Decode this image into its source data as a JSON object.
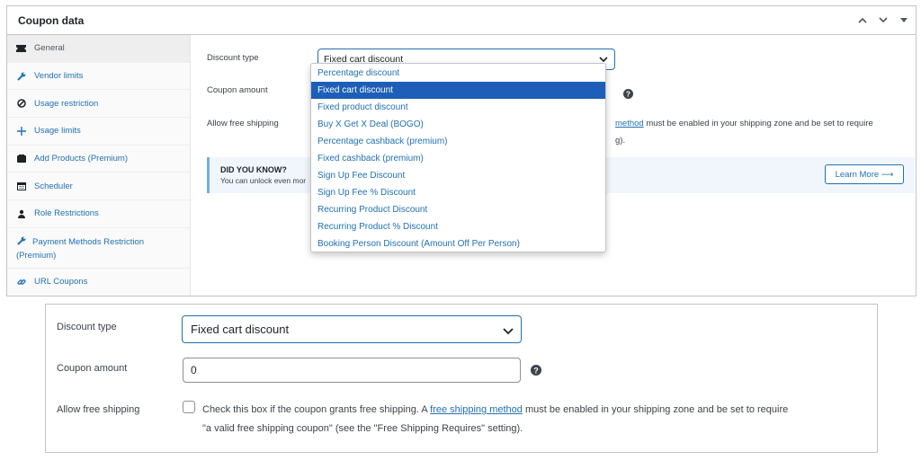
{
  "top_panel": {
    "title": "Coupon data",
    "controls": [
      "chevron-up",
      "chevron-down",
      "triangle-down"
    ],
    "tabs": [
      {
        "label": "General",
        "icon": "ticket-icon",
        "active": true
      },
      {
        "label": "Vendor limits",
        "icon": "wrench-icon"
      },
      {
        "label": "Usage restriction",
        "icon": "block-icon"
      },
      {
        "label": "Usage limits",
        "icon": "plus-icon"
      },
      {
        "label": "Add Products (Premium)",
        "icon": "cart-icon"
      },
      {
        "label": "Scheduler",
        "icon": "calendar-icon"
      },
      {
        "label": "Role Restrictions",
        "icon": "user-icon"
      },
      {
        "label": "Payment Methods Restriction (Premium)",
        "icon": "wrench-icon"
      },
      {
        "label": "URL Coupons",
        "icon": "link-icon"
      }
    ],
    "discount_type_label": "Discount type",
    "discount_type_value": "Fixed cart discount",
    "coupon_amount_label": "Coupon amount",
    "free_shipping_label": "Allow free shipping",
    "shipping_note_link": "method",
    "shipping_note_tail": " must be enabled in your shipping zone and be set to require",
    "shipping_note_line2": "g).",
    "notice_title": "DID YOU KNOW?",
    "notice_text": "You can unlock even mor",
    "learn_more": "Learn More ⟶",
    "dropdown_options": [
      "Percentage discount",
      "Fixed cart discount",
      "Fixed product discount",
      "Buy X Get X Deal (BOGO)",
      "Percentage cashback (premium)",
      "Fixed cashback (premium)",
      "Sign Up Fee Discount",
      "Sign Up Fee % Discount",
      "Recurring Product Discount",
      "Recurring Product % Discount",
      "Booking Person Discount (Amount Off Per Person)"
    ],
    "dropdown_selected": "Fixed cart discount"
  },
  "bottom_panel": {
    "discount_type_label": "Discount type",
    "discount_type_value": "Fixed cart discount",
    "coupon_amount_label": "Coupon amount",
    "coupon_amount_value": "0",
    "free_shipping_label": "Allow free shipping",
    "shipping_text_before": "Check this box if the coupon grants free shipping. A ",
    "shipping_link": "free shipping method",
    "shipping_text_after": " must be enabled in your shipping zone and be set to require",
    "shipping_text_line2": "\"a valid free shipping coupon\" (see the \"Free Shipping Requires\" setting)."
  },
  "colors": {
    "accent": "#2271b1",
    "selected_bg": "#1d5fb8",
    "border": "#c3c4c7",
    "notice_bg": "#f0f6fc"
  }
}
